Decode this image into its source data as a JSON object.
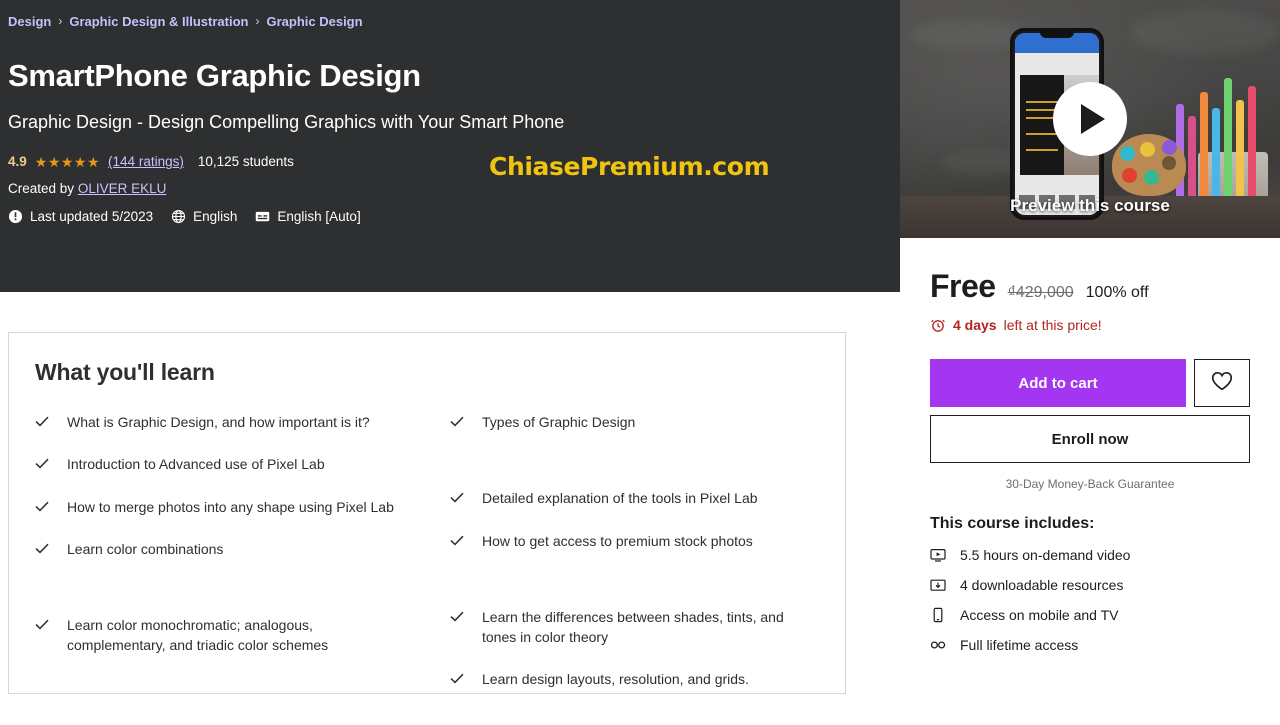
{
  "breadcrumb": {
    "items": [
      "Design",
      "Graphic Design & Illustration",
      "Graphic Design"
    ],
    "separator": "›"
  },
  "hero": {
    "title": "SmartPhone Graphic Design",
    "subtitle": "Graphic Design - Design Compelling Graphics with Your Smart Phone",
    "rating_value": "4.9",
    "stars": "★★★★★",
    "ratings_link": "(144 ratings)",
    "students": "10,125 students",
    "created_by_label": "Created by",
    "instructor": "OLIVER EKLU",
    "last_updated": "Last updated 5/2023",
    "language": "English",
    "captions": "English [Auto]",
    "watermark": "ChiasePremium.com",
    "icons": {
      "updated": "exclamation-circle-icon",
      "language": "globe-icon",
      "captions": "closed-caption-icon"
    }
  },
  "learn": {
    "title": "What you'll learn",
    "check_icon": "check-icon",
    "left_items": [
      "What is Graphic Design, and how important is it?",
      "Introduction to Advanced use of Pixel Lab",
      "How to merge photos into any shape using Pixel Lab",
      "Learn color combinations",
      "Learn color monochromatic; analogous, complementary, and triadic color schemes"
    ],
    "right_items": [
      "Types of Graphic Design",
      "Detailed explanation of the tools in Pixel Lab",
      "How to get access to premium stock photos",
      "Learn the differences between shades, tints, and tones in color theory",
      "Learn design layouts, resolution, and grids."
    ]
  },
  "preview": {
    "label": "Preview this course",
    "play_icon": "play-icon"
  },
  "buybox": {
    "price_current": "Free",
    "price_original": "₫429,000",
    "price_discount": "100% off",
    "deadline_icon": "alarm-clock-icon",
    "deadline_strong": "4 days",
    "deadline_rest": "left at this price!",
    "add_to_cart_label": "Add to cart",
    "wishlist_icon": "heart-icon",
    "enroll_label": "Enroll now",
    "guarantee": "30-Day Money-Back Guarantee",
    "includes_title": "This course includes:",
    "includes": [
      {
        "icon": "video-icon",
        "label": "5.5 hours on-demand video"
      },
      {
        "icon": "download-icon",
        "label": "4 downloadable resources"
      },
      {
        "icon": "mobile-icon",
        "label": "Access on mobile and TV"
      },
      {
        "icon": "infinity-icon",
        "label": "Full lifetime access"
      }
    ]
  },
  "colors": {
    "hero_bg": "#2d2f31",
    "accent_purple": "#a435f0",
    "breadcrumb_link": "#c0c4fc",
    "star_orange": "#e59819",
    "deadline_red": "#b4231f",
    "watermark_yellow": "#f1c40f",
    "border_gray": "#d1d7dc"
  }
}
